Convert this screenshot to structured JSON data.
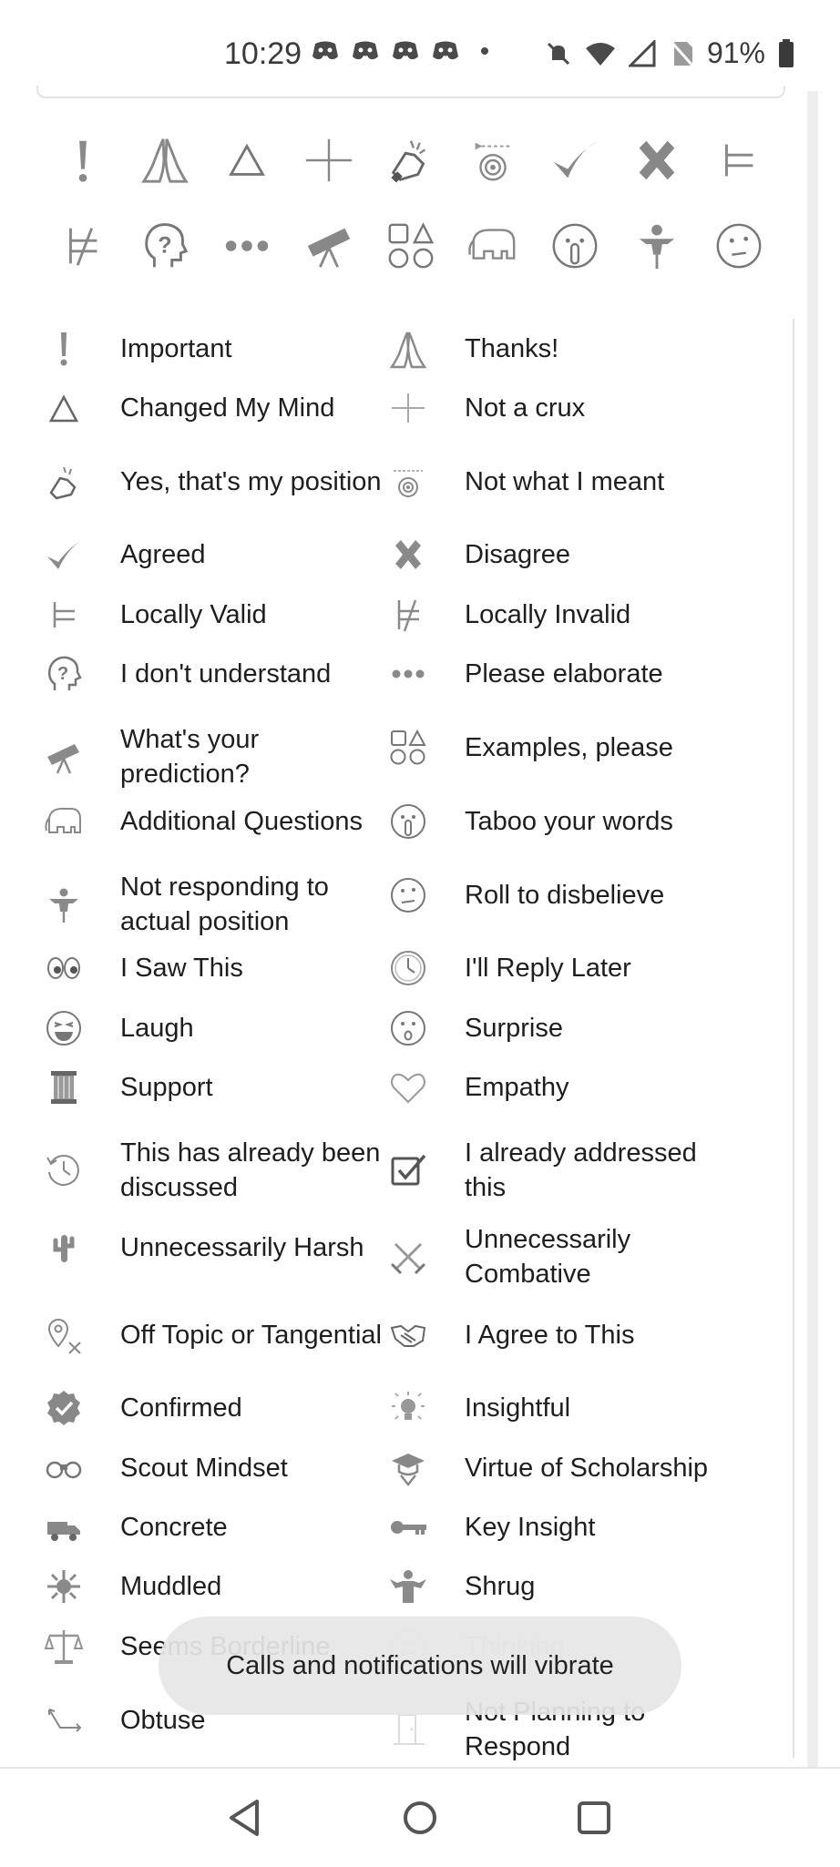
{
  "status_bar": {
    "time": "10:29",
    "battery": "91%",
    "left_icons": [
      "discord-icon",
      "discord-icon",
      "discord-icon",
      "discord-icon"
    ],
    "right_icons": [
      "mute-icon",
      "wifi-icon",
      "signal-icon",
      "no-sim-icon",
      "battery-icon"
    ]
  },
  "grid_icons": [
    "important-icon",
    "thanks-icon",
    "changed-mind-icon",
    "not-crux-icon",
    "yes-my-position-icon",
    "not-what-i-meant-icon",
    "agreed-icon",
    "disagree-icon",
    "locally-valid-icon",
    "locally-invalid-icon",
    "dont-understand-icon",
    "please-elaborate-icon",
    "prediction-icon",
    "examples-icon",
    "additional-questions-icon",
    "taboo-words-icon",
    "not-responding-icon",
    "roll-to-disbelieve-icon"
  ],
  "reactions": [
    {
      "left": "Important",
      "right": "Thanks!"
    },
    {
      "left": "Changed My Mind",
      "right": "Not a crux"
    },
    {
      "left": "Yes, that's my position",
      "right": "Not what I meant"
    },
    {
      "left": "Agreed",
      "right": "Disagree"
    },
    {
      "left": "Locally Valid",
      "right": "Locally Invalid"
    },
    {
      "left": "I don't understand",
      "right": "Please elaborate"
    },
    {
      "left": "What's your prediction?",
      "right": "Examples, please"
    },
    {
      "left": "Additional Questions",
      "right": "Taboo your words"
    },
    {
      "left": "Not responding to actual position",
      "right": "Roll to disbelieve"
    },
    {
      "left": "I Saw This",
      "right": "I'll Reply Later"
    },
    {
      "left": "Laugh",
      "right": "Surprise"
    },
    {
      "left": "Support",
      "right": "Empathy"
    },
    {
      "left": "This has already been discussed",
      "right": "I already addressed this"
    },
    {
      "left": "Unnecessarily Harsh",
      "right": "Unnecessarily Combative"
    },
    {
      "left": "Off Topic or Tangential",
      "right": "I Agree to This"
    },
    {
      "left": "Confirmed",
      "right": "Insightful"
    },
    {
      "left": "Scout Mindset",
      "right": "Virtue of Scholarship"
    },
    {
      "left": "Concrete",
      "right": "Key Insight"
    },
    {
      "left": "Muddled",
      "right": "Shrug"
    },
    {
      "left": "Seems Borderline",
      "right": "Thinking"
    },
    {
      "left": "Obtuse",
      "right": "Not Planning to Respond"
    }
  ],
  "toast": "Calls and notifications will vibrate",
  "nav": {
    "back": "back-icon",
    "home": "home-icon",
    "recents": "recents-icon"
  }
}
